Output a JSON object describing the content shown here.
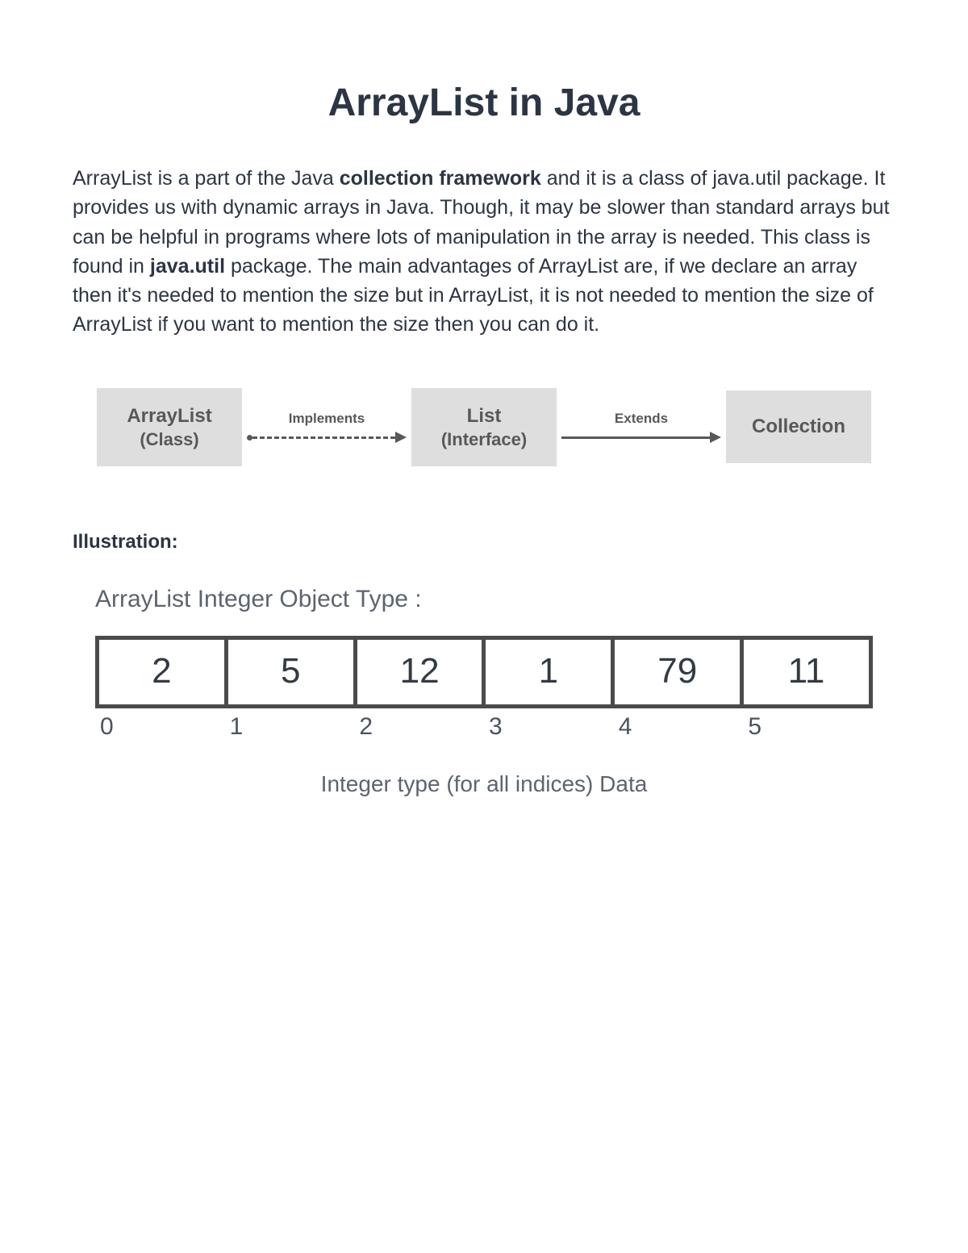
{
  "title": "ArrayList in Java",
  "intro": {
    "part1": " ArrayList is a part of the Java ",
    "bold1": "collection framework",
    "part2": " and it is a class of java.util package. It provides us with dynamic arrays in Java. Though, it may be slower than standard arrays but can be helpful in programs where lots of manipulation in the array is needed. This class is found in ",
    "bold2": "java.util",
    "part3": " package. The main advantages of ArrayList are, if we declare an array then it's needed to mention the size but in ArrayList, it is not needed to mention the size of ArrayList if you want to mention the size then you can do it."
  },
  "hierarchy": {
    "box1_line1": "ArrayList",
    "box1_line2": "(Class)",
    "conn1": "Implements",
    "box2_line1": "List",
    "box2_line2": "(Interface)",
    "conn2": "Extends",
    "box3": "Collection"
  },
  "illustration_heading": "Illustration:",
  "array_subheading": "ArrayList Integer Object Type :",
  "array": {
    "values": [
      "2",
      "5",
      "12",
      "1",
      "79",
      "11"
    ],
    "indices": [
      "0",
      "1",
      "2",
      "3",
      "4",
      "5"
    ]
  },
  "array_caption": "Integer type (for all indices) Data"
}
